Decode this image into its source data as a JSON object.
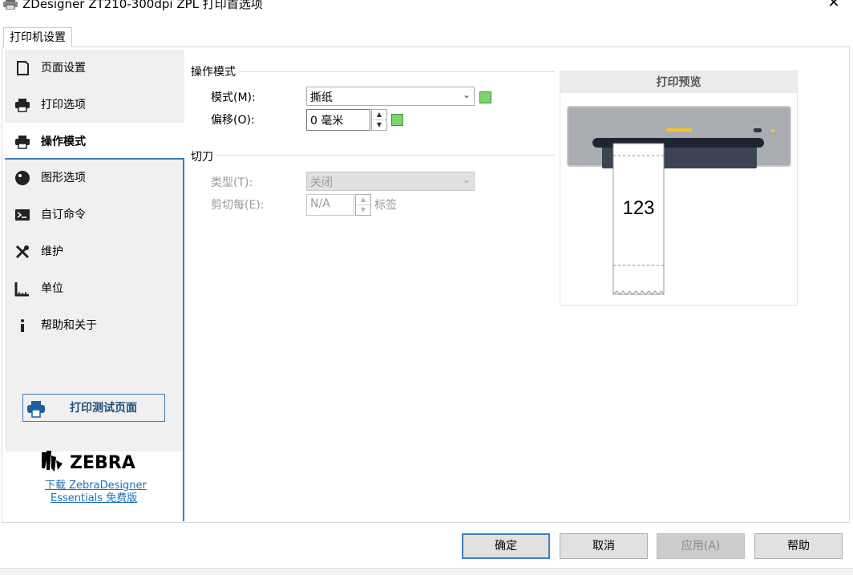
{
  "window": {
    "title": "ZDesigner ZT210-300dpi ZPL 打印首选项",
    "close_glyph": "✕"
  },
  "tabs": [
    {
      "label": "打印机设置"
    }
  ],
  "sidebar": {
    "items": [
      {
        "label": "页面设置",
        "icon": "page-icon"
      },
      {
        "label": "打印选项",
        "icon": "printer-icon"
      },
      {
        "label": "操作模式",
        "icon": "printer-icon",
        "active": true
      },
      {
        "label": "图形选项",
        "icon": "graphics-icon"
      },
      {
        "label": "自订命令",
        "icon": "terminal-icon"
      },
      {
        "label": "维护",
        "icon": "tools-icon"
      },
      {
        "label": "单位",
        "icon": "ruler-icon"
      },
      {
        "label": "帮助和关于",
        "icon": "info-icon"
      }
    ],
    "test_print_label": "打印测试页面",
    "logo_text": "ZEBRA",
    "link_line1": "下载 ZebraDesigner",
    "link_line2": "Essentials 免费版"
  },
  "operation": {
    "section_title": "操作模式",
    "mode_label": "模式(M):",
    "mode_value": "撕纸",
    "offset_label": "偏移(O):",
    "offset_value": "0 毫米"
  },
  "cutter": {
    "section_title": "切刀",
    "type_label": "类型(T):",
    "type_value": "关闭",
    "cut_every_label": "剪切每(E):",
    "cut_every_value": "N/A",
    "cut_every_unit": "标签"
  },
  "preview": {
    "title": "打印预览",
    "label_text": "123"
  },
  "buttons": {
    "ok": "确定",
    "cancel": "取消",
    "apply": "应用(A)",
    "help": "帮助"
  },
  "colors": {
    "accent": "#3a7ebf",
    "indicator_green": "#7ed36b",
    "sidebar_bg": "#f0f0f0"
  }
}
